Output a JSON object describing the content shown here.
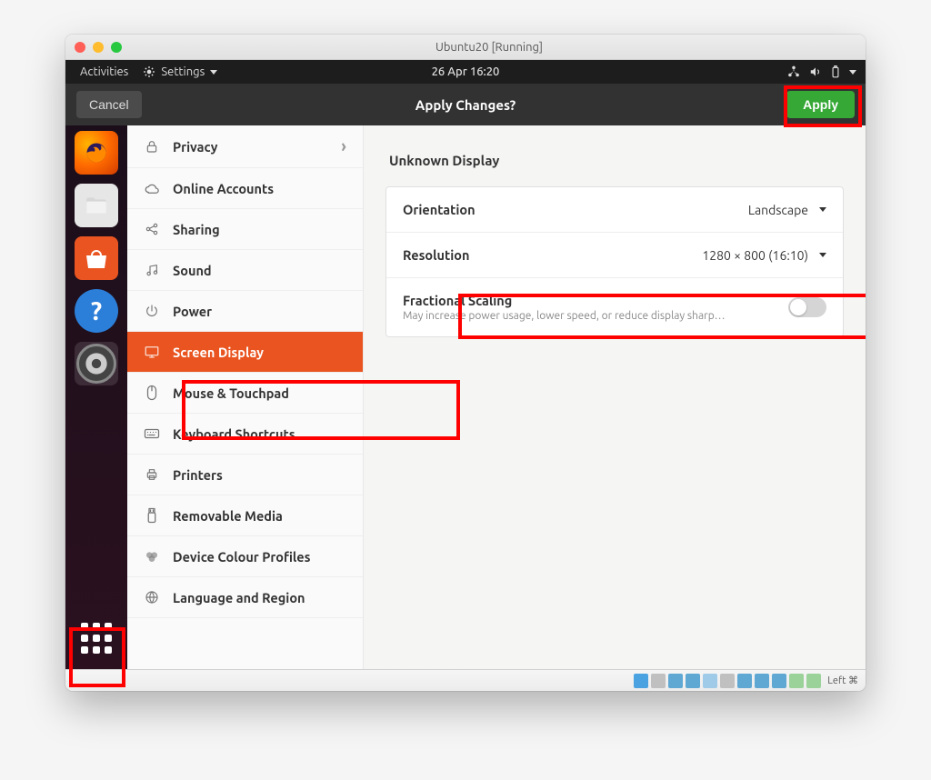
{
  "window": {
    "title": "Ubuntu20 [Running]"
  },
  "gnome_top": {
    "activities": "Activities",
    "app": "Settings",
    "clock": "26 Apr  16:20"
  },
  "header": {
    "cancel": "Cancel",
    "title": "Apply Changes?",
    "apply": "Apply"
  },
  "sidebar": {
    "items": [
      {
        "icon": "lock",
        "label": "Privacy",
        "has_arrow": true
      },
      {
        "icon": "cloud",
        "label": "Online Accounts"
      },
      {
        "icon": "share",
        "label": "Sharing"
      },
      {
        "icon": "music",
        "label": "Sound"
      },
      {
        "icon": "power",
        "label": "Power"
      },
      {
        "icon": "display",
        "label": "Screen Display",
        "selected": true
      },
      {
        "icon": "mouse",
        "label": "Mouse & Touchpad"
      },
      {
        "icon": "keyboard",
        "label": "Keyboard Shortcuts"
      },
      {
        "icon": "printer",
        "label": "Printers"
      },
      {
        "icon": "usb",
        "label": "Removable Media"
      },
      {
        "icon": "color",
        "label": "Device Colour Profiles"
      },
      {
        "icon": "globe",
        "label": "Language and Region"
      }
    ]
  },
  "main": {
    "section_title": "Unknown Display",
    "rows": {
      "orientation": {
        "label": "Orientation",
        "value": "Landscape"
      },
      "resolution": {
        "label": "Resolution",
        "value": "1280 × 800 (16:10)"
      },
      "scaling": {
        "label": "Fractional Scaling",
        "sub": "May increase power usage, lower speed, or reduce display sharp…"
      }
    }
  },
  "vbox_status": {
    "text": "Left ⌘"
  },
  "colors": {
    "accent": "#e95420",
    "apply": "#35a835"
  }
}
